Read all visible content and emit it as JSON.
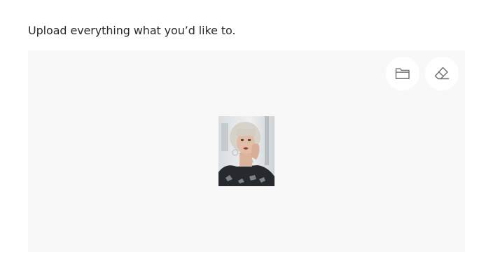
{
  "upload": {
    "prompt": "Upload everything what you’d like to.",
    "actions": {
      "open": {
        "icon": "folder-icon"
      },
      "clear": {
        "icon": "eraser-icon"
      }
    },
    "preview": {
      "image": "uploaded-photo-thumbnail",
      "description_visible": false
    }
  }
}
